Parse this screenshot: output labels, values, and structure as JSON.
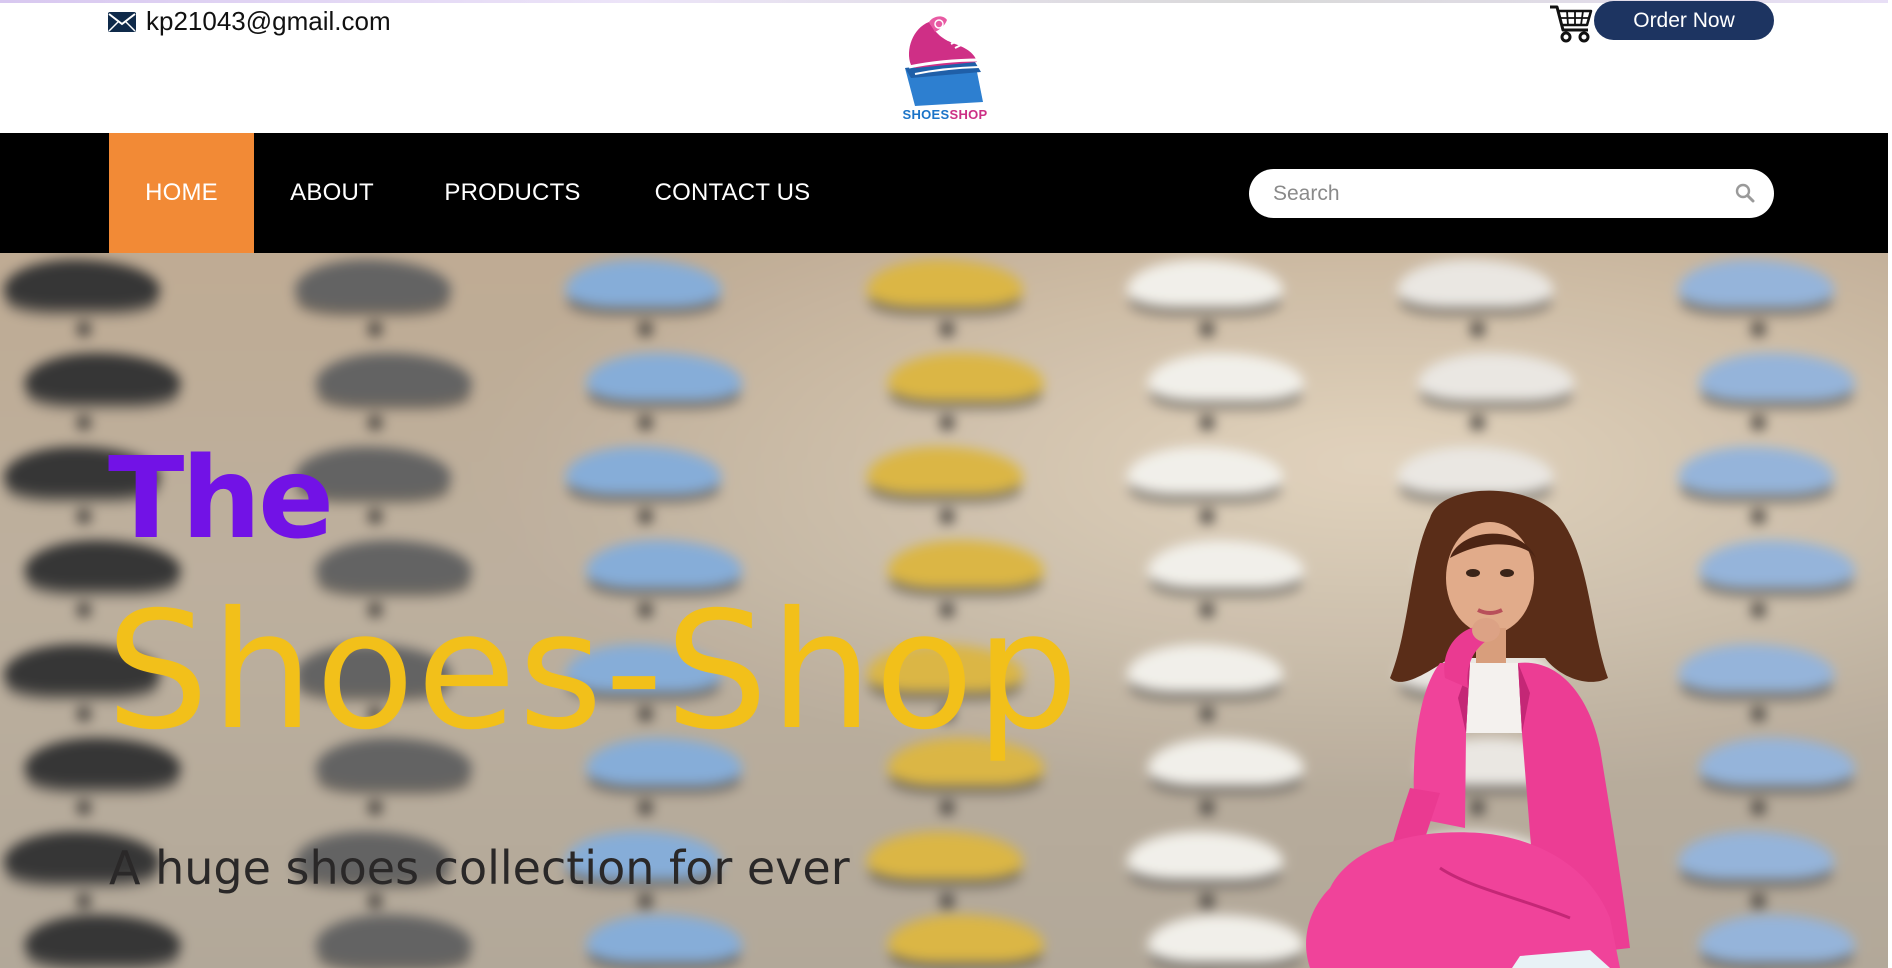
{
  "header": {
    "email": "kp21043@gmail.com",
    "logo_text_part1": "SHOES",
    "logo_text_part2": "SHOP",
    "order_button": "Order Now"
  },
  "nav": {
    "items": [
      {
        "label": "HOME",
        "active": true
      },
      {
        "label": "ABOUT",
        "active": false
      },
      {
        "label": "PRODUCTS",
        "active": false
      },
      {
        "label": "CONTACT US",
        "active": false
      }
    ],
    "search_placeholder": "Search"
  },
  "hero": {
    "the": "The",
    "title": "Shoes-Shop",
    "subtitle": "A huge shoes collection for ever"
  },
  "colors": {
    "nav_background": "#000000",
    "active_nav": "#f28a36",
    "order_button": "#1d3461",
    "hero_the": "#7212e6",
    "hero_title": "#f2c01a",
    "hero_subtitle": "#2a2828"
  },
  "icons": [
    "mail-icon",
    "cart-icon",
    "search-icon",
    "logo-shoe-icon"
  ]
}
